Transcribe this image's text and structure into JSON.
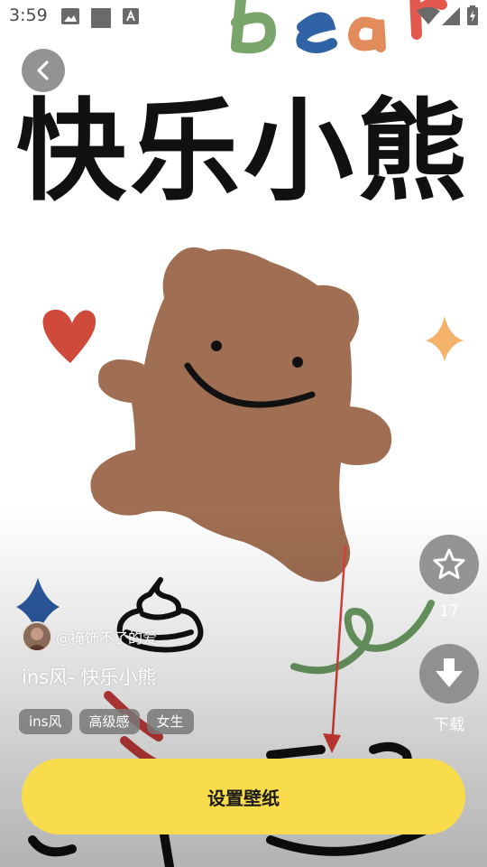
{
  "status_bar": {
    "time": "3:59"
  },
  "wallpaper": {
    "top_lettering": "Bear",
    "headline": "快乐小熊"
  },
  "post": {
    "author": "@掩饰不了的爱",
    "title": "ins风- 快乐小熊",
    "tags": [
      "ins风",
      "高级感",
      "女生"
    ]
  },
  "actions": {
    "favorite_count": "17",
    "download_label": "下载",
    "set_wallpaper_label": "设置壁纸"
  },
  "colors": {
    "button_yellow": "#f8dc4c",
    "bear_brown": "#a06e52",
    "heart_red": "#d04a3c"
  }
}
